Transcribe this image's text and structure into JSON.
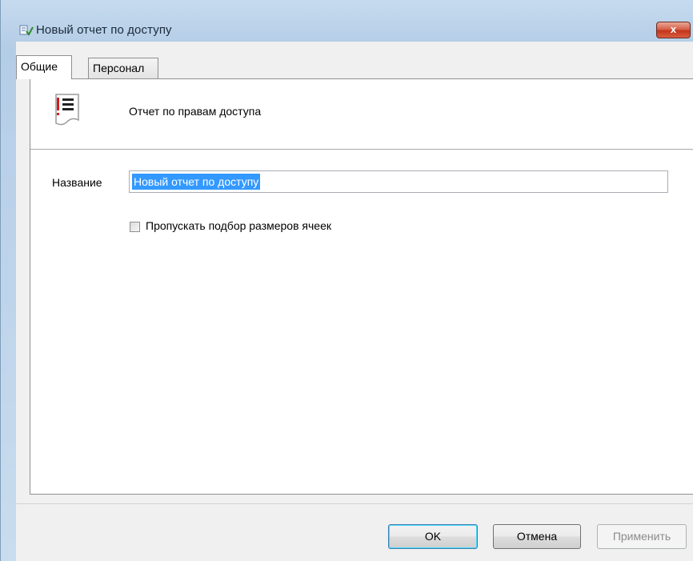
{
  "window": {
    "title": "Новый отчет по доступу",
    "close_label": "x"
  },
  "tabs": [
    {
      "label": "Общие",
      "active": true
    },
    {
      "label": "Персонал",
      "active": false
    }
  ],
  "general": {
    "report_type": "Отчет по правам доступа",
    "name_label": "Название",
    "name_value": "Новый отчет по доступу",
    "skip_cell_sizing_label": "Пропускать подбор размеров ячеек",
    "skip_cell_sizing_checked": false
  },
  "buttons": {
    "ok": "OK",
    "cancel": "Отмена",
    "apply": "Применить"
  },
  "colors": {
    "selection": "#3399ff",
    "close_button": "#c3341b",
    "report_icon_accent": "#d11f1f"
  }
}
